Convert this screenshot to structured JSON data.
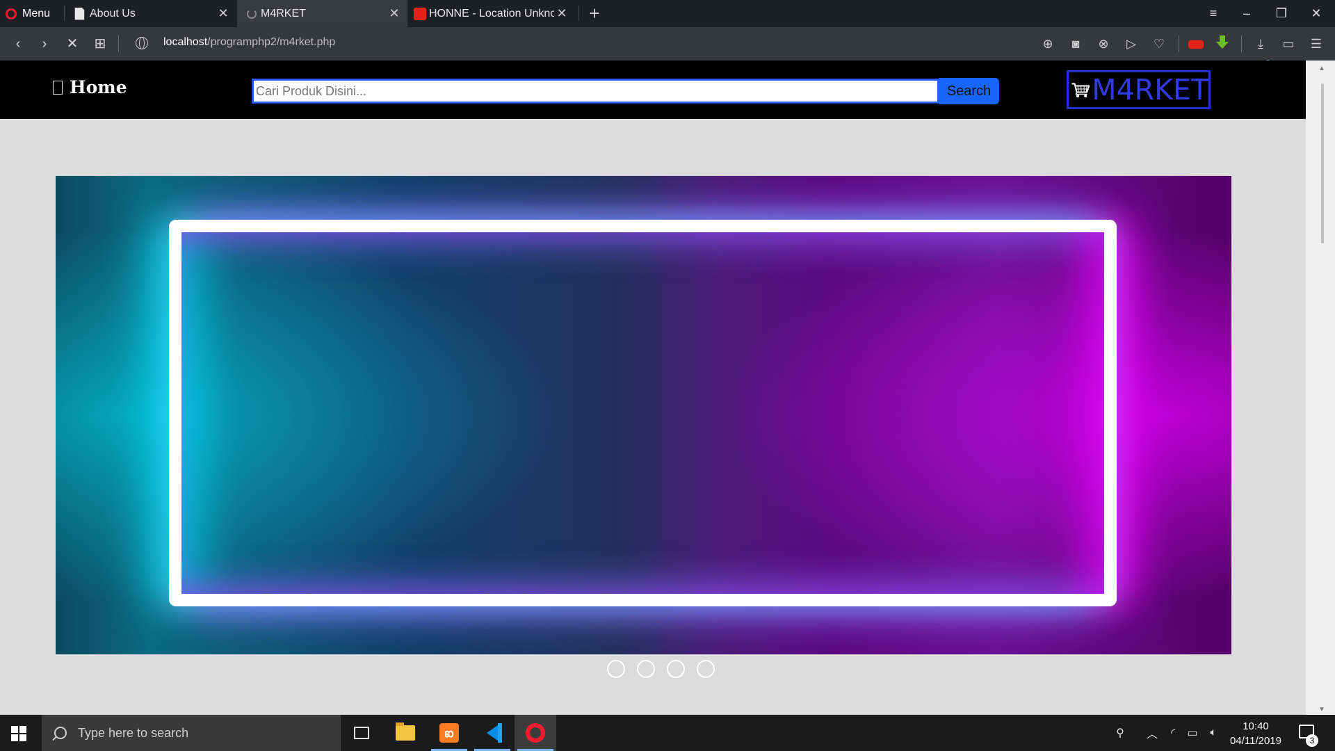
{
  "browser": {
    "menu_label": "Menu",
    "tabs": [
      {
        "title": "About Us",
        "icon": "document-icon",
        "active": false
      },
      {
        "title": "M4RKET",
        "icon": "loading-spinner-icon",
        "active": true
      },
      {
        "title": "HONNE - Location Unknow",
        "icon": "youtube-icon",
        "active": false
      }
    ],
    "address": {
      "host": "localhost",
      "path": "/programphp2/m4rket.php"
    }
  },
  "site": {
    "home_label": "Home",
    "search": {
      "placeholder": "Cari Produk Disini...",
      "button_label": "Search"
    },
    "logo_text": "M4RKET",
    "slider_dots": 4,
    "colors": {
      "header_bg": "#000000",
      "search_button": "#1866ff",
      "logo": "#2f3be0",
      "page_bg": "#dcdcdc",
      "neon_cyan": "#00e6ff",
      "neon_magenta": "#f000ff"
    }
  },
  "taskbar": {
    "search_placeholder": "Type here to search",
    "time": "10:40",
    "date": "04/11/2019",
    "notification_count": "3"
  }
}
